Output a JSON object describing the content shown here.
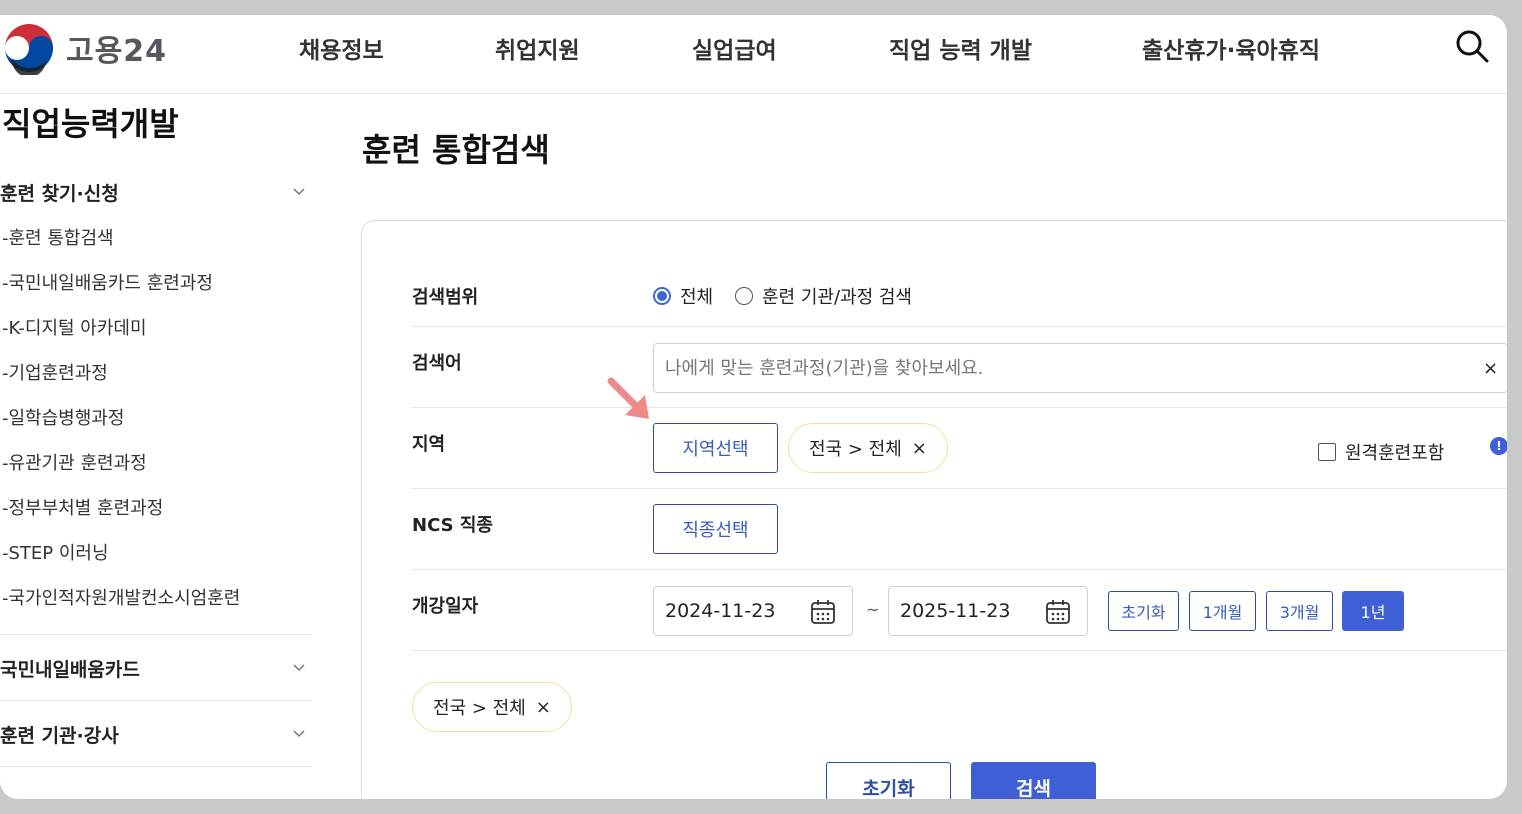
{
  "header": {
    "logo_text": "고용24",
    "nav": [
      "채용정보",
      "취업지원",
      "실업급여",
      "직업 능력 개발",
      "출산휴가·육아휴직"
    ],
    "search_icon": "search-icon"
  },
  "sidebar": {
    "title": "직업능력개발",
    "sections": [
      {
        "label": "훈련 찾기·신청",
        "items": [
          "-훈련 통합검색",
          "-국민내일배움카드 훈련과정",
          "-K-디지털 아카데미",
          "-기업훈련과정",
          "-일학습병행과정",
          "-유관기관 훈련과정",
          "-정부부처별 훈련과정",
          "-STEP 이러닝",
          "-국가인적자원개발컨소시엄훈련"
        ]
      },
      {
        "label": "국민내일배움카드",
        "items": []
      },
      {
        "label": "훈련 기관·강사",
        "items": []
      }
    ]
  },
  "main": {
    "title": "훈련 통합검색",
    "form": {
      "scope": {
        "label": "검색범위",
        "options": [
          "전체",
          "훈련 기관/과정 검색"
        ],
        "selected": "전체"
      },
      "keyword": {
        "label": "검색어",
        "value": "",
        "placeholder": "나에게 맞는 훈련과정(기관)을 찾아보세요.",
        "clear": "×"
      },
      "region": {
        "label": "지역",
        "button": "지역선택",
        "chip": "전국 > 전체",
        "chip_remove": "×",
        "remote_label": "원격훈련포함",
        "remote_checked": false,
        "info": "!"
      },
      "ncs": {
        "label": "NCS 직종",
        "button": "직종선택"
      },
      "date": {
        "label": "개강일자",
        "start": "2024-11-23",
        "end": "2025-11-23",
        "separator": "~",
        "periods": [
          "초기화",
          "1개월",
          "3개월",
          "1년"
        ],
        "active_period": "1년"
      },
      "selected_chip": "전국 > 전체",
      "selected_chip_remove": "×",
      "reset_button": "초기화",
      "search_button": "검색"
    }
  },
  "colors": {
    "accent": "#3f5fd6",
    "outline": "#2d4fa6",
    "chip_border": "#f1e39b",
    "arrow": "#f08a8a"
  }
}
